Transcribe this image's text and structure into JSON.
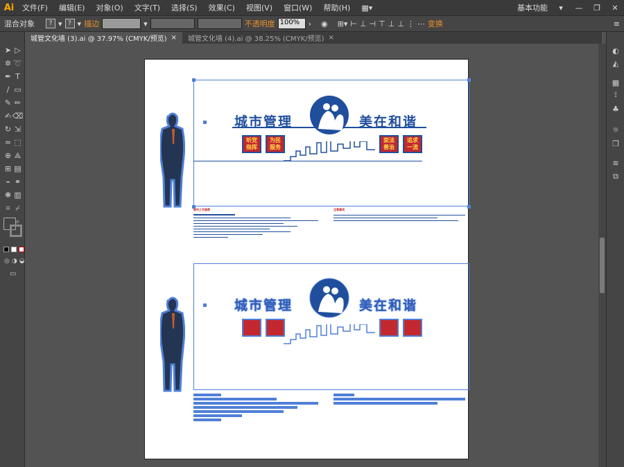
{
  "app": {
    "logo": "Ai"
  },
  "menu": {
    "items": [
      "文件(F)",
      "编辑(E)",
      "对象(O)",
      "文字(T)",
      "选择(S)",
      "效果(C)",
      "视图(V)",
      "窗口(W)",
      "帮助(H)"
    ]
  },
  "workspace": {
    "label": "基本功能"
  },
  "control": {
    "object_type": "混合对象",
    "stroke_label": "描边",
    "opacity_label": "不透明度",
    "opacity_value": "100%",
    "transform_label": "变换"
  },
  "tabs": [
    {
      "label": "城管文化墙 (3).ai @ 37.97% (CMYK/预览)",
      "close": "×"
    },
    {
      "label": "城管文化墙 (4).ai @ 38.25% (CMYK/预览)",
      "close": "×"
    }
  ],
  "artwork": {
    "title_left": "城市管理",
    "title_right": "美在和谐",
    "badges": [
      {
        "l1": "听党",
        "l2": "指挥"
      },
      {
        "l1": "为民",
        "l2": "服务"
      },
      {
        "l1": "崇法",
        "l2": "善治"
      },
      {
        "l1": "追求",
        "l2": "一流"
      }
    ],
    "notes_left_title": "制作工艺推荐",
    "notes_right_title": "注意事项"
  },
  "colors": {
    "brand_blue": "#1f4e9c",
    "badge_red": "#c3282e",
    "selection": "#4f7fd8",
    "app_orange": "#f7a800"
  }
}
